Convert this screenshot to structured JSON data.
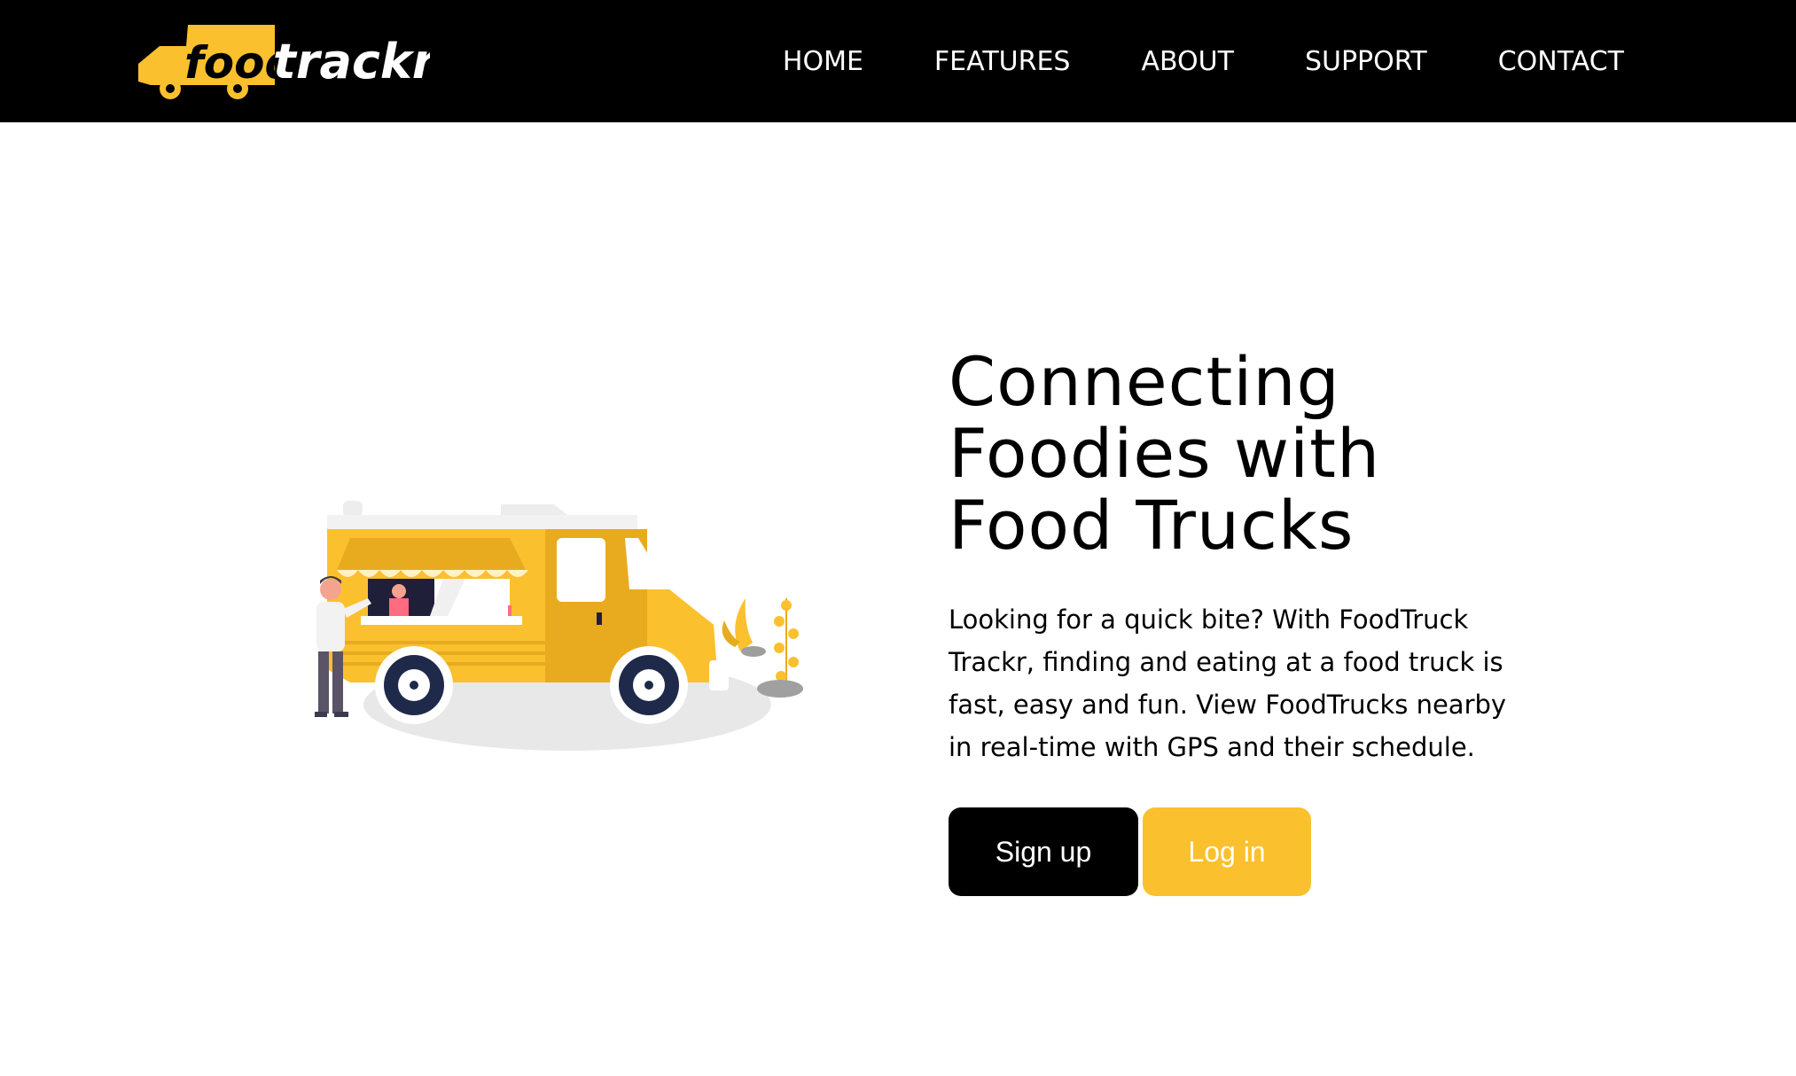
{
  "brand": {
    "logo_text_part1": "food",
    "logo_text_part2": "trackr",
    "accent_color": "#fbc02d"
  },
  "nav": {
    "items": [
      {
        "label": "HOME"
      },
      {
        "label": "FEATURES"
      },
      {
        "label": "ABOUT"
      },
      {
        "label": "SUPPORT"
      },
      {
        "label": "CONTACT"
      }
    ]
  },
  "hero": {
    "title_line1": "Connecting",
    "title_line2": "Foodies with",
    "title_line3": "Food Trucks",
    "description": "Looking for a quick bite? With FoodTruck Trackr, finding and eating at a food truck is fast, easy and fun. View FoodTrucks nearby in real-time with GPS and their schedule.",
    "signup_label": "Sign up",
    "login_label": "Log in"
  },
  "colors": {
    "navbar_bg": "#000000",
    "signup_bg": "#000000",
    "login_bg": "#fbc02d"
  }
}
